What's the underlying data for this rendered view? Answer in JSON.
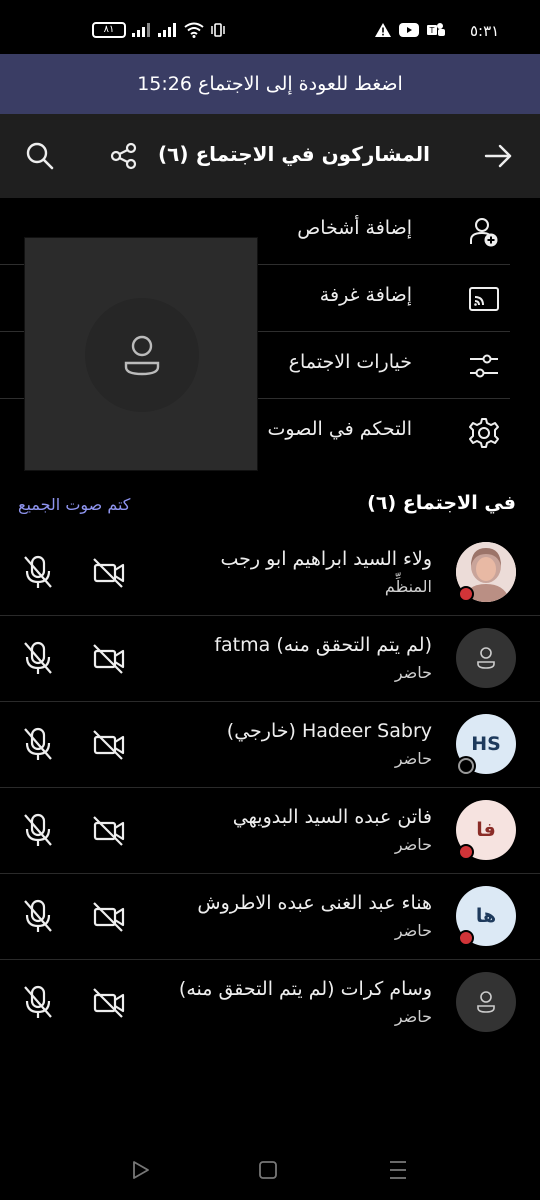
{
  "status_bar": {
    "time": "٥:٣١",
    "battery": "٨١",
    "icons": [
      "warning-icon",
      "youtube-icon",
      "teams-icon",
      "wifi-icon",
      "signal-icon",
      "vibrate-icon"
    ]
  },
  "banner": {
    "text": "اضغط للعودة إلى الاجتماع 15:26"
  },
  "header": {
    "title": "المشاركون في الاجتماع (٦)",
    "back_icon": "arrow-right-icon",
    "share_icon": "share-icon",
    "search_icon": "search-icon"
  },
  "menu": {
    "items": [
      {
        "label": "إضافة أشخاص",
        "icon": "add-person-icon"
      },
      {
        "label": "إضافة غرفة",
        "icon": "cast-room-icon"
      },
      {
        "label": "خيارات الاجتماع",
        "icon": "sliders-icon"
      },
      {
        "label": "التحكم في الصوت",
        "icon": "gear-icon"
      }
    ]
  },
  "section": {
    "title": "في الاجتماع (٦)",
    "mute_all": "كتم صوت الجميع"
  },
  "participants": [
    {
      "name": "ولاء السيد ابراهيم ابو رجب",
      "role": "المنظِّم",
      "avatar": "photo",
      "presence": "busy"
    },
    {
      "name": "(لم يتم التحقق منه) fatma",
      "role": "حاضر",
      "avatar": "placeholder",
      "presence": "none"
    },
    {
      "name": "Hadeer Sabry (خارجي)",
      "role": "حاضر",
      "avatar_initials": "HS",
      "presence": "offline"
    },
    {
      "name": "فاتن عبده السيد البدويهي",
      "role": "حاضر",
      "avatar_initials": "فا",
      "presence": "busy"
    },
    {
      "name": "هناء عبد الغنى عبده الاطروش",
      "role": "حاضر",
      "avatar_initials": "ها",
      "presence": "busy"
    },
    {
      "name": "وسام كرات  (لم يتم التحقق منه)",
      "role": "حاضر",
      "avatar": "placeholder",
      "presence": "none"
    }
  ],
  "colors": {
    "banner": "#3a3d64",
    "header": "#1f1f1f",
    "accent_link": "#8f95f0",
    "presence_busy": "#d13438"
  }
}
